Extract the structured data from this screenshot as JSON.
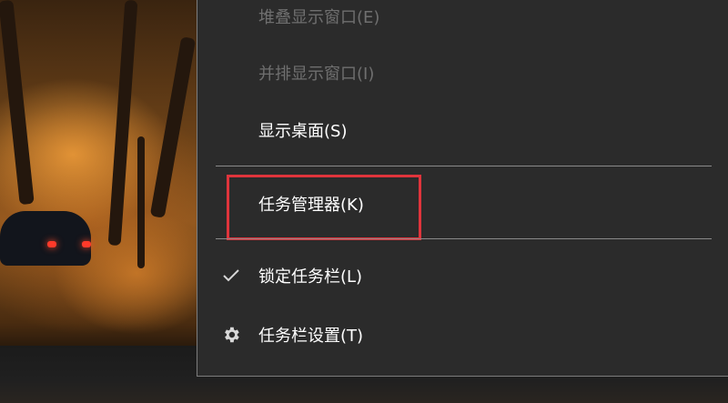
{
  "context_menu": {
    "items": [
      {
        "label": "堆叠显示窗口(E)",
        "enabled": false
      },
      {
        "label": "并排显示窗口(I)",
        "enabled": false
      },
      {
        "label": "显示桌面(S)",
        "enabled": true
      },
      {
        "label": "任务管理器(K)",
        "enabled": true
      },
      {
        "label": "锁定任务栏(L)",
        "enabled": true,
        "icon": "checkmark-icon"
      },
      {
        "label": "任务栏设置(T)",
        "enabled": true,
        "icon": "gear-icon"
      }
    ],
    "highlight_color": "#e0343c"
  }
}
